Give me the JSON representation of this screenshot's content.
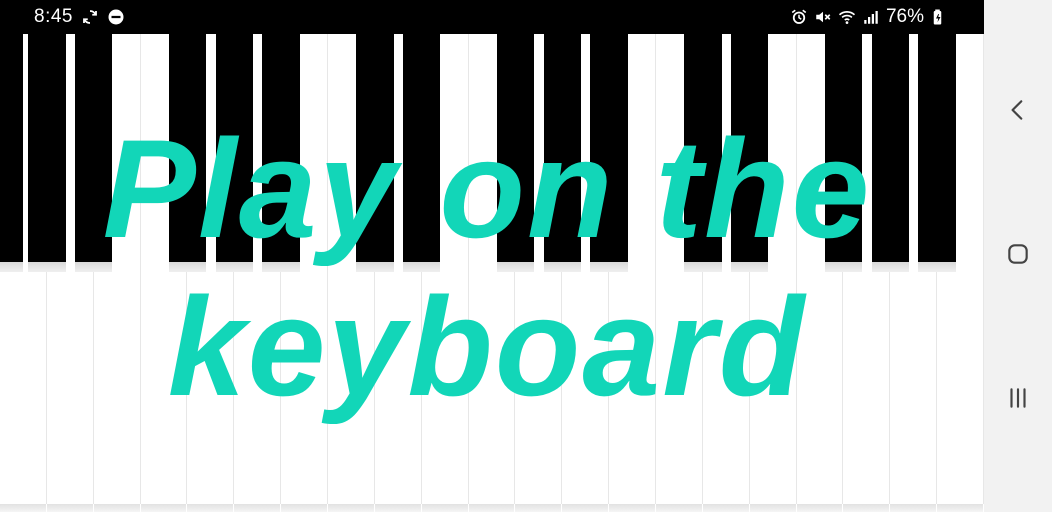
{
  "status_bar": {
    "time": "8:45",
    "battery": "76%",
    "left_icons": [
      "sync-icon",
      "dell-app-icon"
    ],
    "right_icons": [
      "alarm-icon",
      "mute-icon",
      "wifi-icon",
      "signal-icon",
      "battery-icon"
    ]
  },
  "overlay": {
    "line1": "Play on the",
    "line2": "keyboard",
    "color": "#12d6b8"
  },
  "keyboard": {
    "white_key_count": 21,
    "black_keys_per_octave_pattern": [
      1,
      1,
      0,
      1,
      1,
      1,
      0
    ]
  },
  "navigation_bar": {
    "buttons": [
      "back-icon",
      "home-icon",
      "recents-icon"
    ]
  }
}
